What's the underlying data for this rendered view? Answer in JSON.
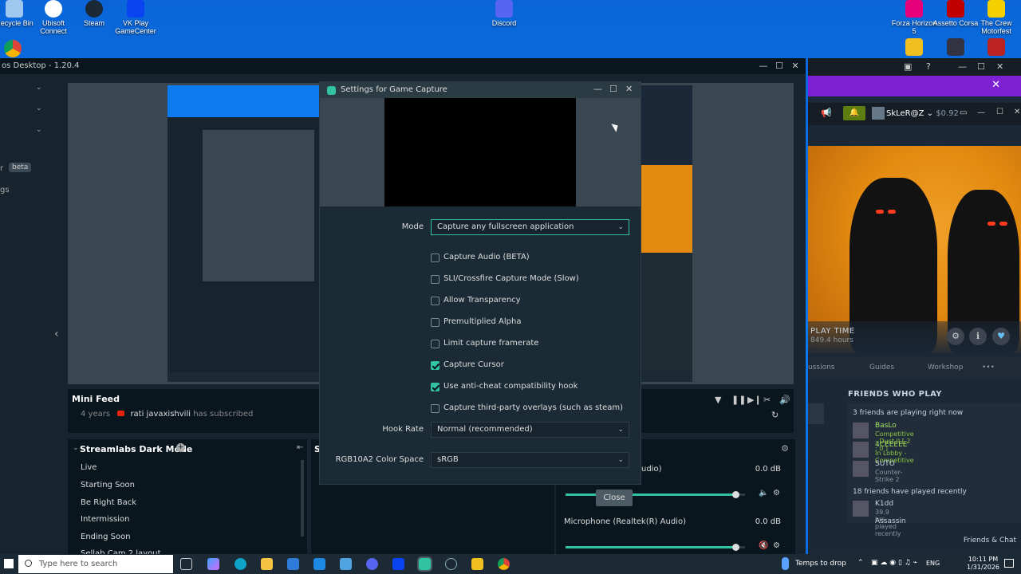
{
  "desktop": {
    "icons": [
      {
        "label": "Recycle Bin",
        "icon": "recycle-bin-icon",
        "color": "#9fc8f0"
      },
      {
        "label": "Ubisoft Connect",
        "icon": "ubisoft-icon",
        "color": "#ffffff"
      },
      {
        "label": "Steam",
        "icon": "steam-icon",
        "color": "#1b2838"
      },
      {
        "label": "VK Play GameCenter",
        "icon": "vk-play-icon",
        "color": "#0a43f0"
      },
      {
        "label": "Discord",
        "icon": "discord-icon",
        "color": "#5865f2"
      },
      {
        "label": "Forza Horizon 5",
        "icon": "forza-icon",
        "color": "#e6007a"
      },
      {
        "label": "Assetto Corsa",
        "icon": "assetto-corsa-icon",
        "color": "#c00000"
      },
      {
        "label": "The Crew Motorfest",
        "icon": "the-crew-icon",
        "color": "#f5d000"
      }
    ]
  },
  "streamlabs": {
    "title": "os Desktop - 1.20.4",
    "beta_label": "r",
    "beta_badge": "beta",
    "sidebar_label": "gs",
    "mini_feed": {
      "title": "Mini Feed",
      "row_time": "4 years",
      "row_name": "rati javaxishvili",
      "row_action": "has subscribed"
    },
    "scenes": {
      "title": "Streamlabs Dark Mode",
      "items": [
        "Live",
        "Starting Soon",
        "Be Right Back",
        "Intermission",
        "Ending Soon",
        "Sellab Cam 2 layout"
      ]
    },
    "sources_initial": "S",
    "mixer": {
      "items": [
        {
          "label": "udio)",
          "db": "0.0 dB",
          "level": 0.95
        },
        {
          "label": "Microphone (Realtek(R) Audio)",
          "db": "0.0 dB",
          "level": 0.95
        }
      ]
    },
    "accent": "#31c3a2"
  },
  "dialog": {
    "title": "Settings for Game Capture",
    "mode_label": "Mode",
    "mode_value": "Capture any fullscreen application",
    "checkboxes": [
      {
        "label": "Capture Audio (BETA)",
        "checked": false
      },
      {
        "label": "SLI/Crossfire Capture Mode (Slow)",
        "checked": false
      },
      {
        "label": "Allow Transparency",
        "checked": false
      },
      {
        "label": "Premultiplied Alpha",
        "checked": false
      },
      {
        "label": "Limit capture framerate",
        "checked": false
      },
      {
        "label": "Capture Cursor",
        "checked": true
      },
      {
        "label": "Use anti-cheat compatibility hook",
        "checked": true
      },
      {
        "label": "Capture third-party overlays (such as steam)",
        "checked": false
      }
    ],
    "hook_rate_label": "Hook Rate",
    "hook_rate_value": "Normal (recommended)",
    "color_space_label": "RGB10A2 Color Space",
    "color_space_value": "sRGB",
    "close_label": "Close"
  },
  "steam": {
    "username": "SkLeR@Z",
    "balance": "$0.92",
    "playtime_label": "PLAY TIME",
    "playtime_value": "849.4 hours",
    "tabs": [
      "ussions",
      "Guides",
      "Workshop",
      "•••"
    ],
    "friends_title": "FRIENDS WHO PLAY",
    "playing_now": "3 friends are playing right now",
    "friends": [
      {
        "name": "BasLo",
        "status": "Competitive - Dust II [ 2 : 0 ]",
        "online": true
      },
      {
        "name": "4CEEEEE",
        "status": "In Lobby - Competitive",
        "online": true
      },
      {
        "name": "SUTO",
        "status": "Counter-Strike 2",
        "online": false
      }
    ],
    "played_recently": "18 friends have played recently",
    "recent": [
      {
        "name": "K1dd",
        "status": "39.9 hrs played recently"
      },
      {
        "name": "Assassin",
        "status": ""
      }
    ],
    "friends_chat": "Friends & Chat",
    "banner_color": "#7c22d4"
  },
  "taskbar": {
    "search_placeholder": "Type here to search",
    "weather": "Temps to drop",
    "lang": "ENG",
    "time": "10:11 PM",
    "date": "1/31/2026"
  }
}
